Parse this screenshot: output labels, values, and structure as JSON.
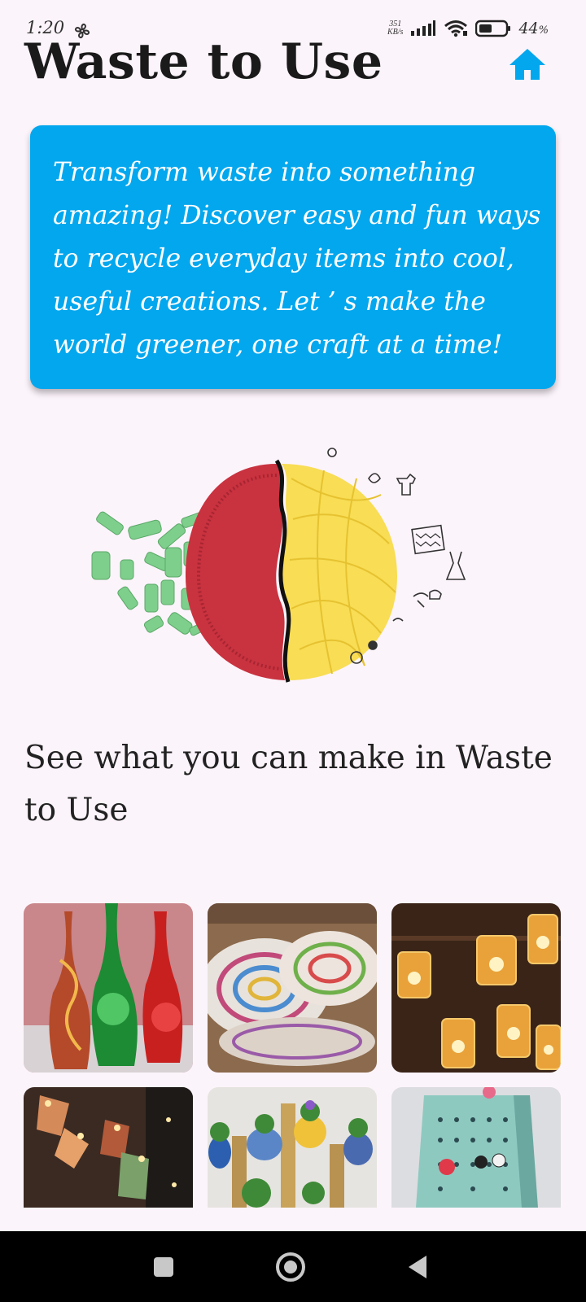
{
  "status_bar": {
    "time": "1:20",
    "net_speed_value": "351",
    "net_speed_unit": "KB/s",
    "battery_percent": "44",
    "battery_unit": "%"
  },
  "header": {
    "title": "Waste to Use",
    "home_icon": "home-icon"
  },
  "intro": {
    "text": "Transform waste into something amazing! Discover easy and fun ways to recycle everyday items into cool, useful creations. Let ’ s make the world greener, one craft at a time!"
  },
  "section": {
    "heading": "See what you can make in Waste to Use"
  },
  "gallery": {
    "items": [
      {
        "name": "painted-bottle-lamps"
      },
      {
        "name": "paper-coil-bowls"
      },
      {
        "name": "mason-jar-lights"
      },
      {
        "name": "cup-string-lights"
      },
      {
        "name": "bottle-planters"
      },
      {
        "name": "grater-jewelry-holder"
      }
    ]
  },
  "colors": {
    "accent": "#03a7ee",
    "background": "#fcf4fb",
    "nav": "#000000"
  },
  "navigation": {
    "recents_icon": "square-icon",
    "home_icon": "circle-icon",
    "back_icon": "triangle-back-icon"
  }
}
